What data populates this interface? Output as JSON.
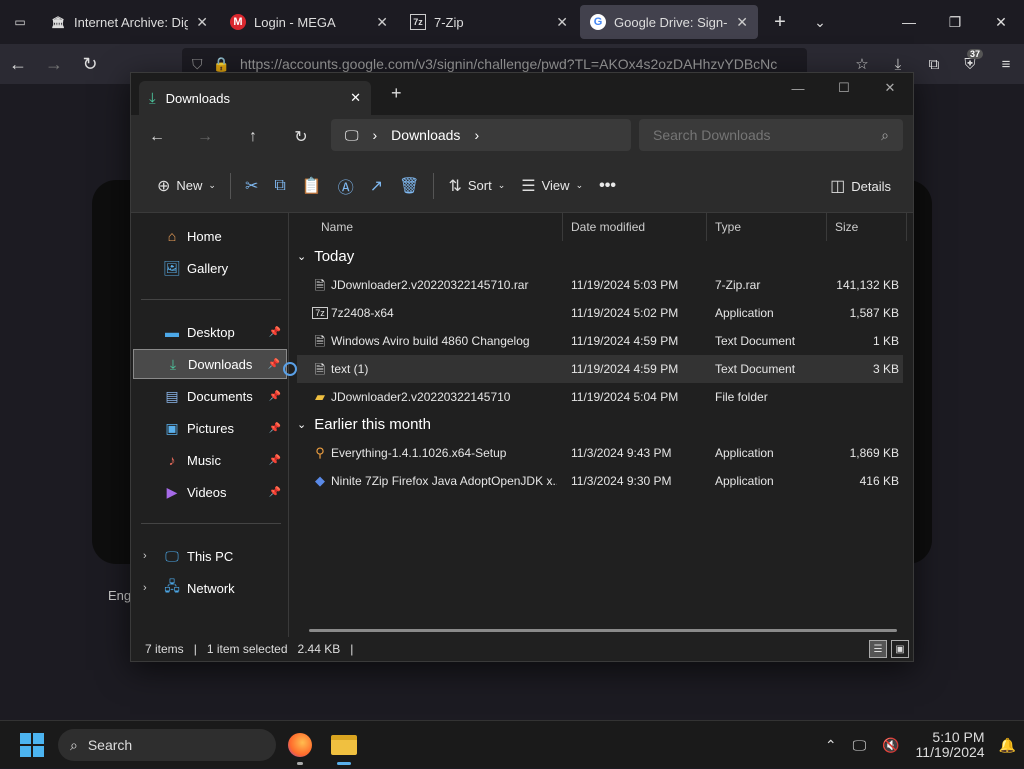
{
  "browser": {
    "tabs": [
      {
        "title": "Internet Archive: Digita",
        "icon": "archive-icon",
        "active": false
      },
      {
        "title": "Login - MEGA",
        "icon": "mega-icon",
        "active": false
      },
      {
        "title": "7-Zip",
        "icon": "7zip-icon",
        "active": false
      },
      {
        "title": "Google Drive: Sign-in",
        "icon": "google-icon",
        "active": true
      }
    ],
    "url": "https://accounts.google.com/v3/signin/challenge/pwd?TL=AKOx4s2ozDAHhzvYDBcNc",
    "extension_badge": "37",
    "page_footer_text": "Eng"
  },
  "explorer": {
    "tab_title": "Downloads",
    "breadcrumb": "Downloads",
    "search_placeholder": "Search Downloads",
    "commands": {
      "new": "New",
      "sort": "Sort",
      "view": "View",
      "details": "Details"
    },
    "nav": {
      "home": "Home",
      "gallery": "Gallery",
      "desktop": "Desktop",
      "downloads": "Downloads",
      "documents": "Documents",
      "pictures": "Pictures",
      "music": "Music",
      "videos": "Videos",
      "this_pc": "This PC",
      "network": "Network"
    },
    "columns": {
      "name": "Name",
      "date": "Date modified",
      "type": "Type",
      "size": "Size"
    },
    "groups": {
      "today": "Today",
      "earlier": "Earlier this month"
    },
    "files": [
      {
        "name": "JDownloader2.v20220322145710.rar",
        "date": "11/19/2024 5:03 PM",
        "type": "7-Zip.rar",
        "size": "141,132 KB"
      },
      {
        "name": "7z2408-x64",
        "date": "11/19/2024 5:02 PM",
        "type": "Application",
        "size": "1,587 KB"
      },
      {
        "name": "Windows Aviro build 4860 Changelog",
        "date": "11/19/2024 4:59 PM",
        "type": "Text Document",
        "size": "1 KB"
      },
      {
        "name": "text (1)",
        "date": "11/19/2024 4:59 PM",
        "type": "Text Document",
        "size": "3 KB"
      },
      {
        "name": "JDownloader2.v20220322145710",
        "date": "11/19/2024 5:04 PM",
        "type": "File folder",
        "size": ""
      },
      {
        "name": "Everything-1.4.1.1026.x64-Setup",
        "date": "11/3/2024 9:43 PM",
        "type": "Application",
        "size": "1,869 KB"
      },
      {
        "name": "Ninite 7Zip Firefox Java AdoptOpenJDK x...",
        "date": "11/3/2024 9:30 PM",
        "type": "Application",
        "size": "416 KB"
      }
    ],
    "status": {
      "count": "7 items",
      "selected": "1 item selected",
      "size": "2.44 KB"
    }
  },
  "taskbar": {
    "search_label": "Search",
    "time": "5:10 PM",
    "date": "11/19/2024"
  },
  "colors": {
    "accent": "#4cb4f0",
    "folder": "#f0c040"
  }
}
